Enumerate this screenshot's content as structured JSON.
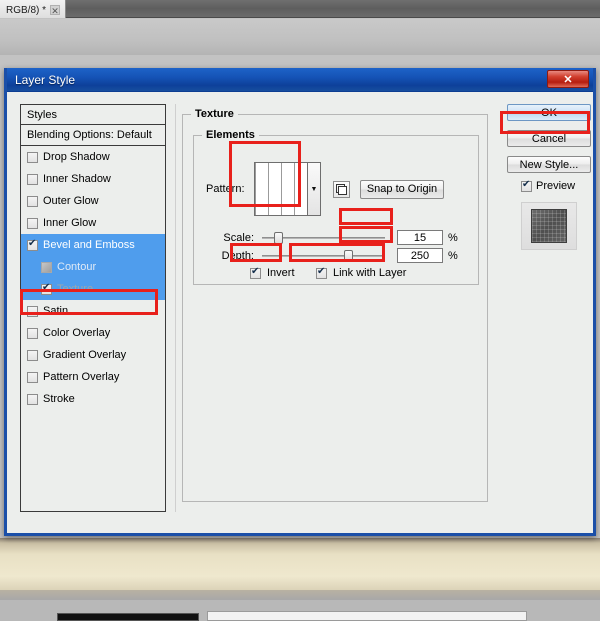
{
  "app": {
    "tab_label": "RGB/8) *",
    "tab_close_icon": "close-icon"
  },
  "dialog": {
    "title": "Layer Style",
    "close_icon": "✕"
  },
  "styles_panel": {
    "header": "Styles",
    "blending_options": "Blending Options: Default",
    "items": [
      {
        "label": "Drop Shadow",
        "checked": false,
        "selected": false,
        "sub": false
      },
      {
        "label": "Inner Shadow",
        "checked": false,
        "selected": false,
        "sub": false
      },
      {
        "label": "Outer Glow",
        "checked": false,
        "selected": false,
        "sub": false
      },
      {
        "label": "Inner Glow",
        "checked": false,
        "selected": false,
        "sub": false
      },
      {
        "label": "Bevel and Emboss",
        "checked": true,
        "selected": true,
        "sub": false
      },
      {
        "label": "Contour",
        "checked": false,
        "selected": false,
        "sub": true
      },
      {
        "label": "Texture",
        "checked": true,
        "selected": true,
        "sub": true
      },
      {
        "label": "Satin",
        "checked": false,
        "selected": false,
        "sub": false
      },
      {
        "label": "Color Overlay",
        "checked": false,
        "selected": false,
        "sub": false
      },
      {
        "label": "Gradient Overlay",
        "checked": false,
        "selected": false,
        "sub": false
      },
      {
        "label": "Pattern Overlay",
        "checked": false,
        "selected": false,
        "sub": false
      },
      {
        "label": "Stroke",
        "checked": false,
        "selected": false,
        "sub": false
      }
    ]
  },
  "texture": {
    "group_title": "Texture",
    "elements_title": "Elements",
    "pattern_label": "Pattern:",
    "new_pattern_icon": "new-pattern-icon",
    "snap_button": "Snap to Origin",
    "scale_label": "Scale:",
    "scale_value": "15",
    "scale_unit": "%",
    "depth_label": "Depth:",
    "depth_value": "250",
    "depth_unit": "%",
    "invert_label": "Invert",
    "invert_checked": true,
    "link_label": "Link with Layer",
    "link_checked": true
  },
  "buttons": {
    "ok": "OK",
    "cancel": "Cancel",
    "new_style": "New Style...",
    "preview_label": "Preview",
    "preview_checked": true
  },
  "colors": {
    "titlebar_blue": "#1553b6",
    "selection_blue": "#4f9ded",
    "annotation_red": "#e8201b",
    "close_red": "#b51d10",
    "dialog_bg": "#eceeec"
  }
}
